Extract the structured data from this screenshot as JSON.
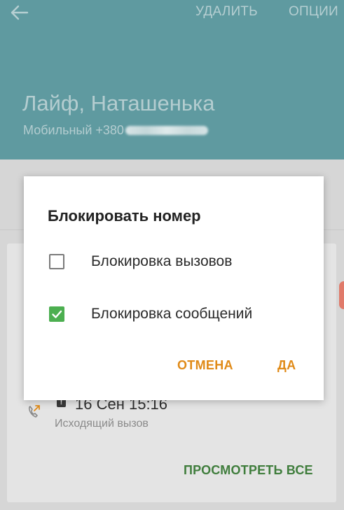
{
  "header": {
    "delete_label": "УДАЛИТЬ",
    "options_label": "ОПЦИИ",
    "contact_name": "Лайф, Наташенька",
    "phone_label": "Мобильный +380"
  },
  "call_log": {
    "date": "16 Сен 15:16",
    "type": "Исходящий вызов",
    "view_all_label": "ПРОСМОТРЕТЬ ВСЕ"
  },
  "dialog": {
    "title": "Блокировать номер",
    "options": [
      {
        "label": "Блокировка вызовов",
        "checked": false
      },
      {
        "label": "Блокировка сообщений",
        "checked": true
      }
    ],
    "cancel_label": "ОТМЕНА",
    "ok_label": "ДА"
  },
  "colors": {
    "header_bg": "#5f9aa0",
    "accent_orange": "#e08a17",
    "checkbox_green": "#4caf50",
    "view_all_green": "#3f7d3c"
  },
  "icons": [
    "back-arrow-icon",
    "outgoing-call-icon",
    "info-icon",
    "checkbox-icon",
    "checkmark-icon"
  ]
}
